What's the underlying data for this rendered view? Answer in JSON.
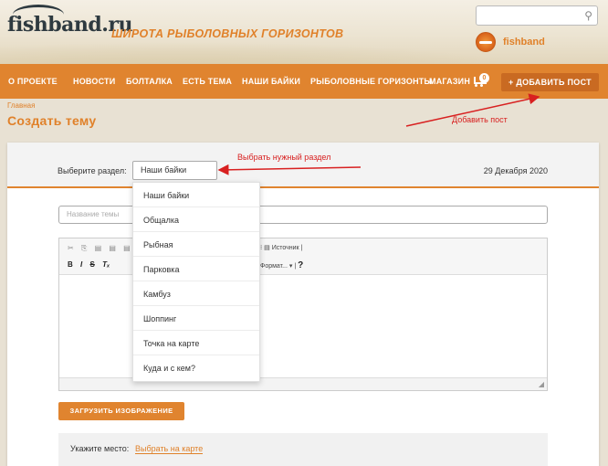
{
  "header": {
    "logo": "fishband.ru",
    "slogan": "ШИРОТА РЫБОЛОВНЫХ ГОРИЗОНТОВ",
    "search_placeholder": "",
    "username": "fishband"
  },
  "nav": {
    "items": [
      "О ПРОЕКТЕ",
      "НОВОСТИ",
      "БОЛТАЛКА",
      "ЕСТЬ ТЕМА",
      "НАШИ БАЙКИ",
      "РЫБОЛОВНЫЕ ГОРИЗОНТЫ",
      "МАГАЗИН"
    ],
    "cart_count": "0",
    "add_post": "+ ДОБАВИТЬ ПОСТ"
  },
  "breadcrumb": "Главная",
  "page_title": "Создать тему",
  "annotations": {
    "choose_section": "Выбрать нужный раздел",
    "add_post": "Добавить пост"
  },
  "form": {
    "section_label": "Выберите раздел:",
    "section_selected": "Наши байки",
    "date": "29 Декабря 2020",
    "title_placeholder": "Название темы",
    "source_button": "Источник",
    "format_button": "Формат...",
    "upload_button": "ЗАГРУЗИТЬ ИЗОБРАЖЕНИЕ",
    "place_label": "Укажите место:",
    "place_link": "Выбрать на карте"
  },
  "dropdown": {
    "options": [
      "Наши байки",
      "Общалка",
      "Рыбная",
      "Парковка",
      "Камбуз",
      "Шоппинг",
      "Точка на карте",
      "Куда и с кем?"
    ]
  },
  "colors": {
    "accent": "#e0842f",
    "annotation": "#d82020"
  }
}
